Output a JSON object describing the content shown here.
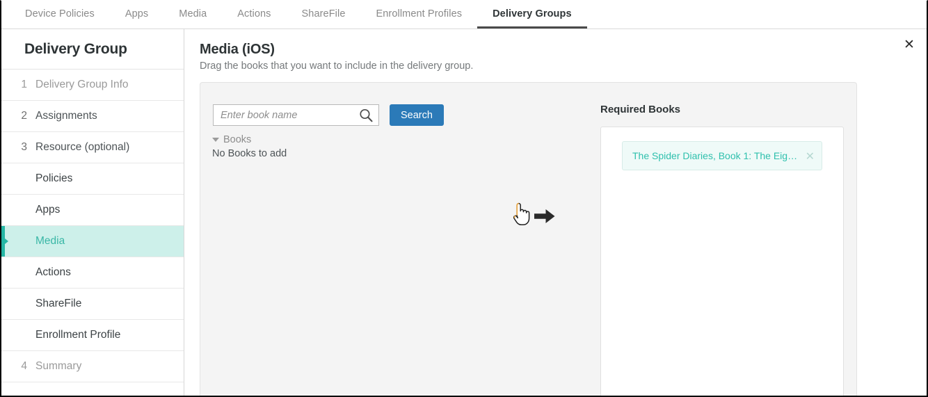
{
  "tabs": [
    {
      "label": "Device Policies",
      "active": false
    },
    {
      "label": "Apps",
      "active": false
    },
    {
      "label": "Media",
      "active": false
    },
    {
      "label": "Actions",
      "active": false
    },
    {
      "label": "ShareFile",
      "active": false
    },
    {
      "label": "Enrollment Profiles",
      "active": false
    },
    {
      "label": "Delivery Groups",
      "active": true
    }
  ],
  "sidebar": {
    "title": "Delivery Group",
    "items": [
      {
        "num": "1",
        "label": "Delivery Group Info",
        "state": "muted"
      },
      {
        "num": "2",
        "label": "Assignments",
        "state": "normal"
      },
      {
        "num": "3",
        "label": "Resource (optional)",
        "state": "normal"
      },
      {
        "num": "",
        "label": "Policies",
        "state": "sub"
      },
      {
        "num": "",
        "label": "Apps",
        "state": "sub"
      },
      {
        "num": "",
        "label": "Media",
        "state": "active"
      },
      {
        "num": "",
        "label": "Actions",
        "state": "sub"
      },
      {
        "num": "",
        "label": "ShareFile",
        "state": "sub"
      },
      {
        "num": "",
        "label": "Enrollment Profile",
        "state": "sub"
      },
      {
        "num": "4",
        "label": "Summary",
        "state": "muted"
      }
    ]
  },
  "content": {
    "close_label": "✕",
    "title": "Media (iOS)",
    "subtitle": "Drag the books that you want to include in the delivery group.",
    "search": {
      "placeholder": "Enter book name",
      "value": "",
      "button_label": "Search",
      "icon": "search-icon"
    },
    "books_group_label": "Books",
    "no_books_text": "No Books to add",
    "drag_hint": {
      "cursor_icon": "pointing-hand-cursor-icon",
      "arrow_icon": "arrow-right-icon"
    },
    "required": {
      "title": "Required Books",
      "books": [
        {
          "label": "The Spider Diaries, Book 1: The Eight-l...",
          "remove_label": "✕"
        }
      ]
    }
  },
  "colors": {
    "accent_teal": "#25b6a4",
    "chip_text": "#2fc0ad",
    "chip_bg": "#effaf8",
    "primary_blue": "#2b7ab8",
    "panel_bg": "#f4f4f4",
    "active_nav_bg": "#cdf0ea"
  }
}
